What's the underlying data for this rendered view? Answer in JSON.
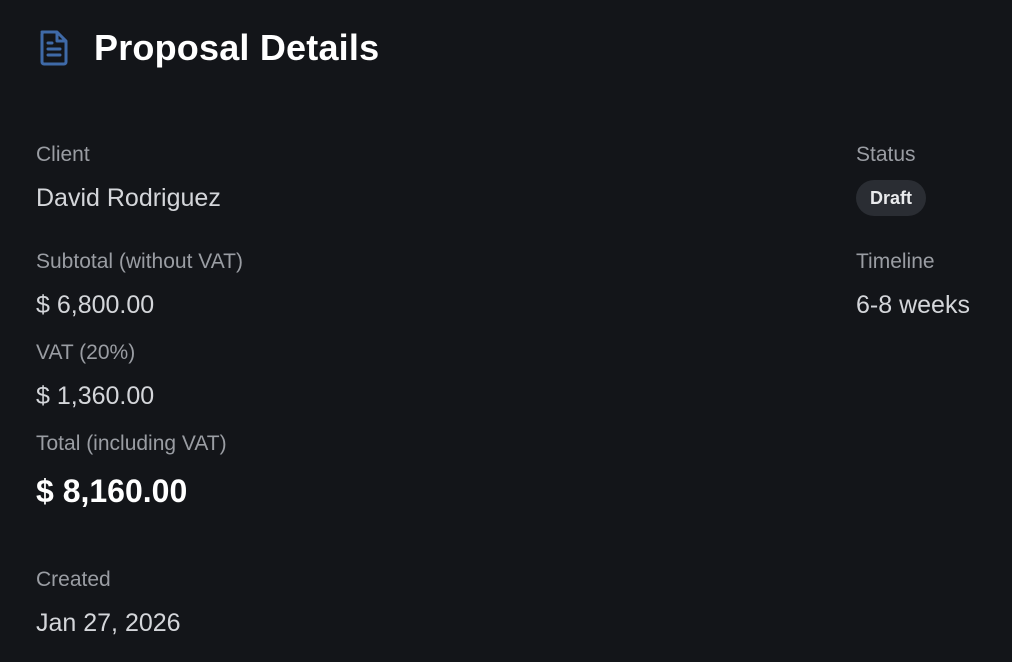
{
  "header": {
    "title": "Proposal Details",
    "icon": "document-icon",
    "icon_color": "#3f6aa8"
  },
  "details": {
    "client_label": "Client",
    "client_value": "David Rodriguez",
    "subtotal_label": "Subtotal (without VAT)",
    "subtotal_value": "$ 6,800.00",
    "vat_label": "VAT (20%)",
    "vat_value": "$ 1,360.00",
    "total_label": "Total (including VAT)",
    "total_value": "$ 8,160.00",
    "created_label": "Created",
    "created_value": "Jan 27, 2026",
    "status_label": "Status",
    "status_value": "Draft",
    "timeline_label": "Timeline",
    "timeline_value": "6-8 weeks"
  },
  "colors": {
    "background": "#131519",
    "badge_bg": "#2a2d33",
    "label": "#9a9da3",
    "value": "#d4d6da"
  }
}
